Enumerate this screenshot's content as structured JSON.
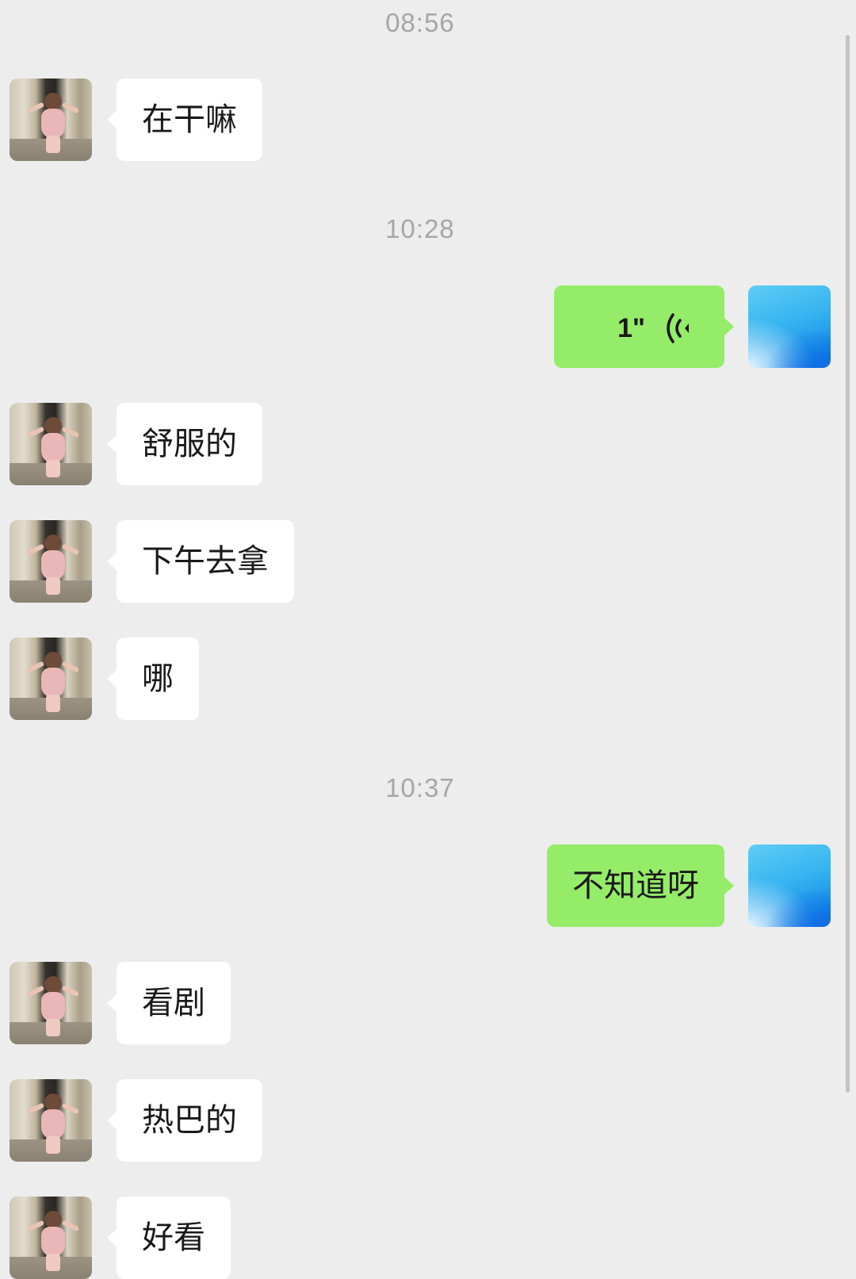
{
  "chat": {
    "timestamps": [
      "08:56",
      "10:28",
      "10:37"
    ],
    "messages": [
      {
        "sender": "them",
        "text": "在干嘛"
      },
      {
        "sender": "me",
        "type": "voice",
        "duration": "1\""
      },
      {
        "sender": "them",
        "text": "舒服的"
      },
      {
        "sender": "them",
        "text": "下午去拿"
      },
      {
        "sender": "them",
        "text": "哪"
      },
      {
        "sender": "me",
        "text": "不知道呀"
      },
      {
        "sender": "them",
        "text": "看剧"
      },
      {
        "sender": "them",
        "text": "热巴的"
      },
      {
        "sender": "them",
        "text": "好看"
      }
    ]
  },
  "colors": {
    "background": "#ededed",
    "bubble_incoming": "#ffffff",
    "bubble_outgoing": "#95ec69",
    "timestamp": "#a6a6a6",
    "text": "#191919"
  },
  "icons": {
    "voice": "voice-wave-icon",
    "avatar_incoming": "ballet-child-avatar",
    "avatar_outgoing": "blue-gradient-avatar"
  }
}
